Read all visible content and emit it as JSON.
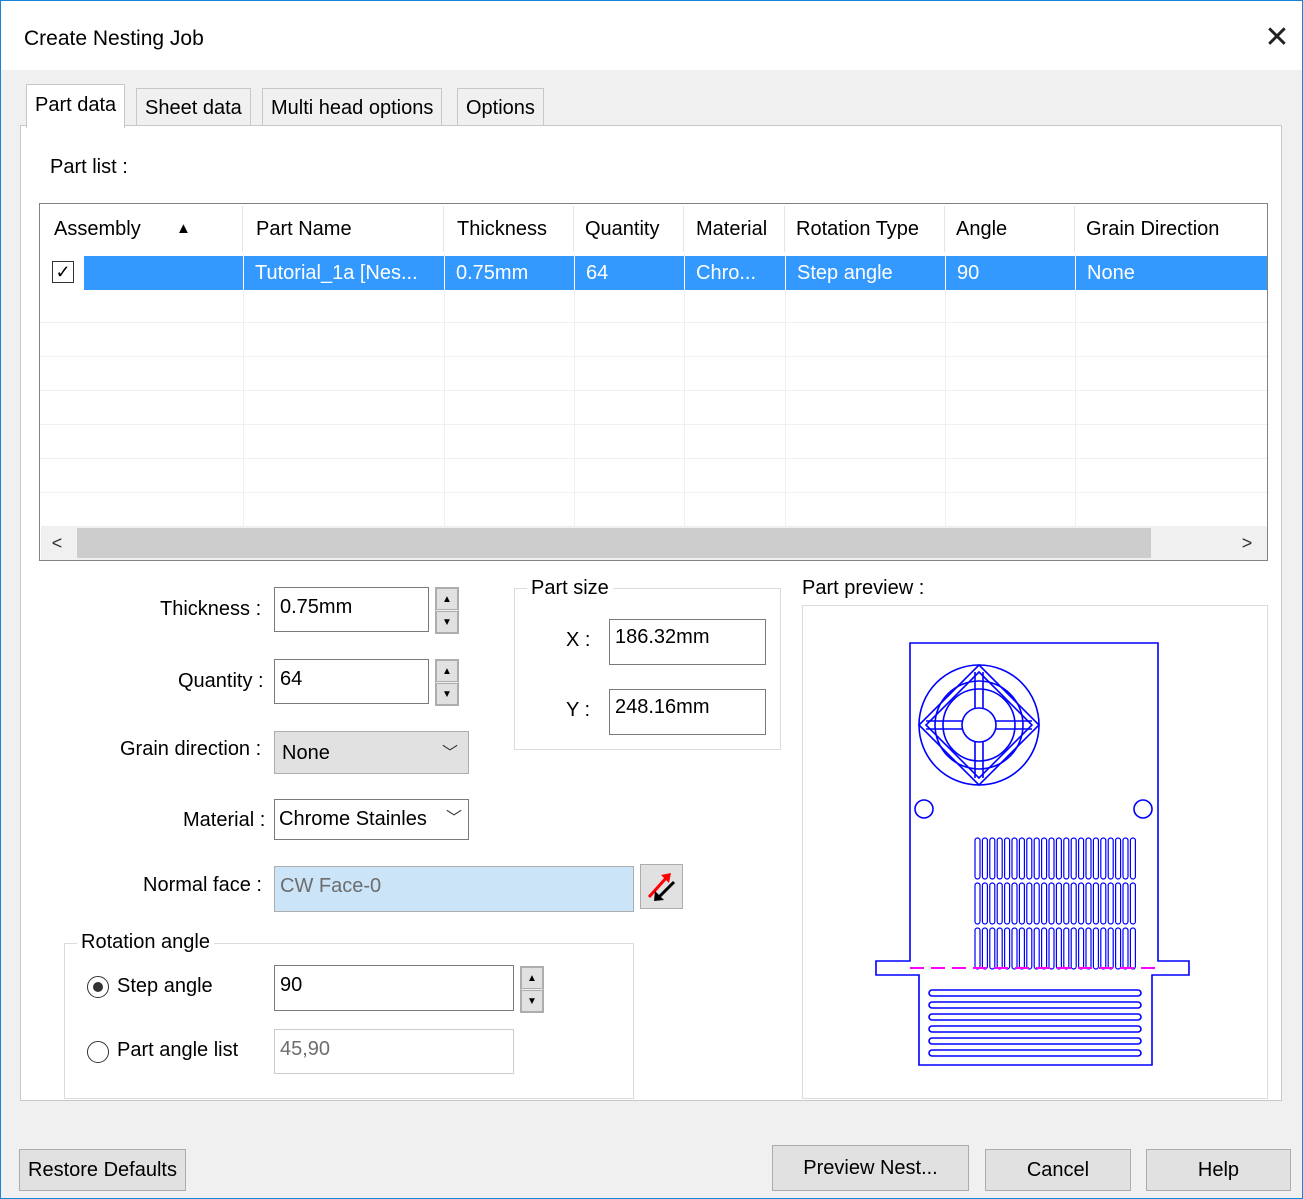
{
  "window": {
    "title": "Create Nesting Job",
    "close_glyph": "✕"
  },
  "tabs": [
    {
      "label": "Part data"
    },
    {
      "label": "Sheet data"
    },
    {
      "label": "Multi head options"
    },
    {
      "label": "Options"
    }
  ],
  "part_list": {
    "label": "Part list :",
    "columns": [
      "Assembly",
      "Part Name",
      "Thickness",
      "Quantity",
      "Material",
      "Rotation Type",
      "Angle",
      "Grain Direction"
    ],
    "sort_glyph": "▲",
    "rows": [
      {
        "assembly_checked": true,
        "part_name": "Tutorial_1a [Nes...",
        "thickness": "0.75mm",
        "quantity": "64",
        "material": "Chro...",
        "rotation_type": "Step angle",
        "angle": "90",
        "grain_direction": "None"
      }
    ],
    "scroll_left": "<",
    "scroll_right": ">"
  },
  "form": {
    "thickness": {
      "label": "Thickness :",
      "value": "0.75mm"
    },
    "quantity": {
      "label": "Quantity :",
      "value": "64"
    },
    "grain_direction": {
      "label": "Grain direction :",
      "value": "None"
    },
    "material": {
      "label": "Material :",
      "value": "Chrome Stainles"
    },
    "normal_face": {
      "label": "Normal face :",
      "value": "CW Face-0"
    }
  },
  "part_size": {
    "title": "Part size",
    "x_label": "X :",
    "x_value": "186.32mm",
    "y_label": "Y :",
    "y_value": "248.16mm"
  },
  "rotation_angle": {
    "title": "Rotation angle",
    "step_angle_label": "Step angle",
    "step_angle_value": "90",
    "part_angle_list_label": "Part angle list",
    "part_angle_list_value": "45,90",
    "selected": "step_angle"
  },
  "preview": {
    "label": "Part preview :"
  },
  "spin_glyphs": {
    "up": "▲",
    "down": "▼"
  },
  "dropdown_glyph": "﹀",
  "buttons": {
    "restore_defaults": "Restore Defaults",
    "preview_nest": "Preview Nest...",
    "cancel": "Cancel",
    "help": "Help"
  },
  "colors": {
    "accent": "#1883d7",
    "selection": "#3399ff",
    "preview_lines": "#0000ff",
    "bend_line": "#ff00ff"
  }
}
